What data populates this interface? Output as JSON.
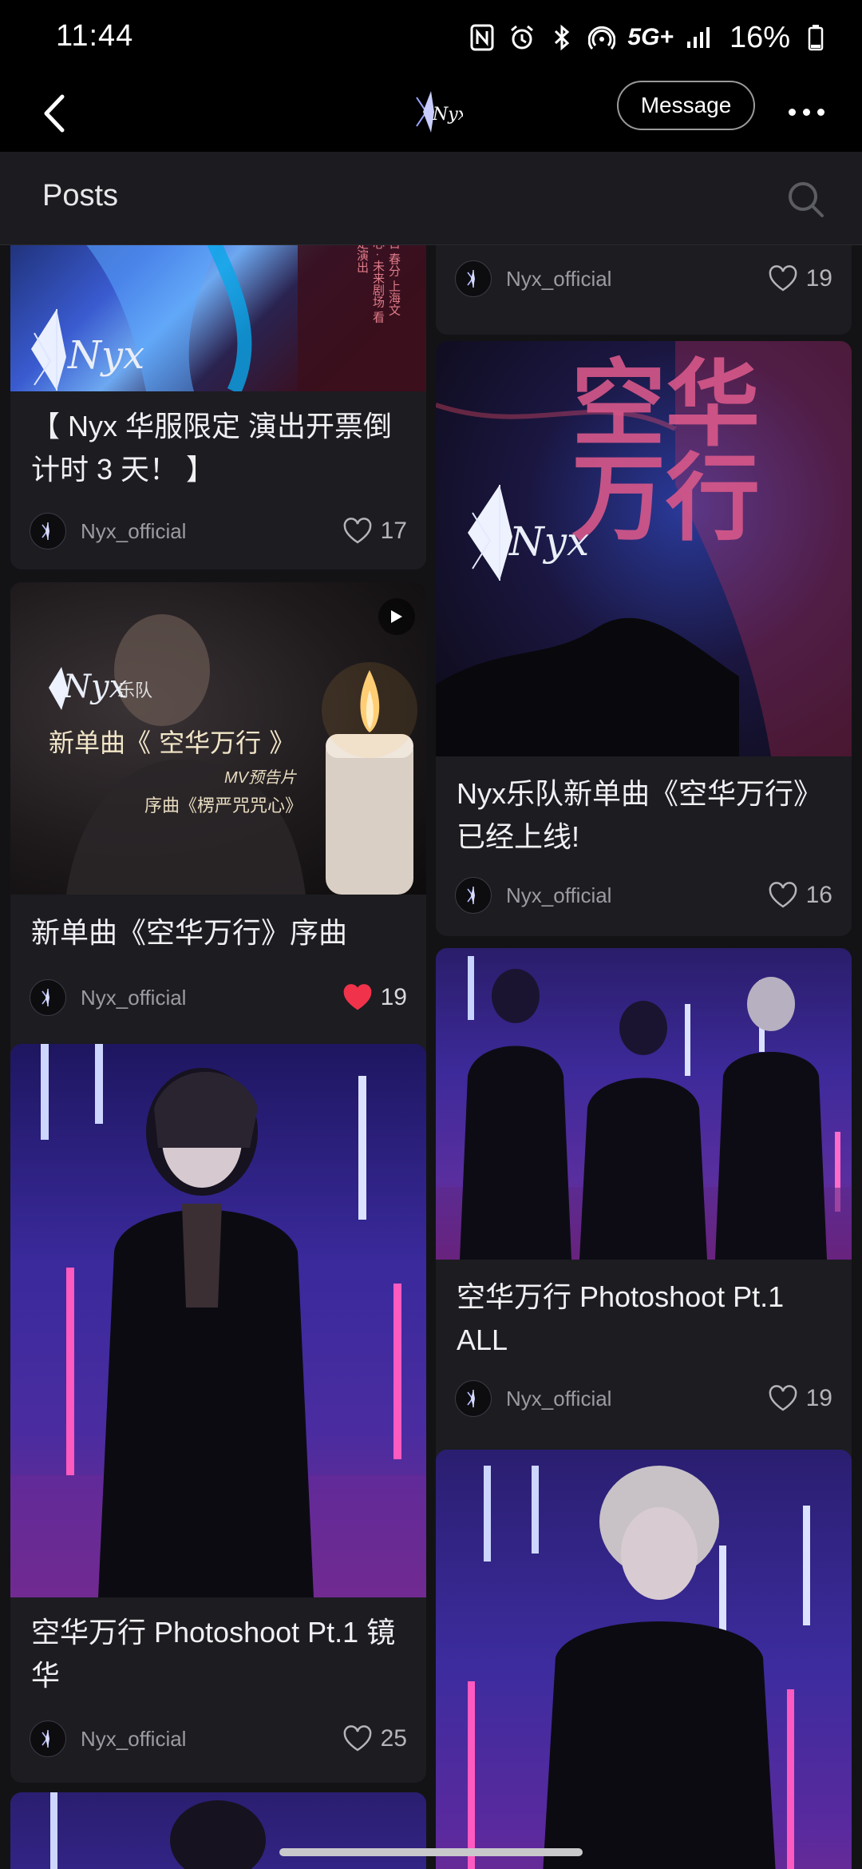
{
  "status_bar": {
    "time": "11:44",
    "network": "5G+",
    "battery": "16%",
    "icons": [
      "nfc-icon",
      "alarm-icon",
      "bluetooth-icon",
      "hotspot-icon",
      "signal-icon",
      "battery-icon"
    ]
  },
  "top_bar": {
    "back_icon": "chevron-left-icon",
    "logo_text": "Nyx",
    "message_label": "Message",
    "more_icon": "more-horizontal-icon"
  },
  "posts_header": {
    "title": "Posts",
    "search_icon": "search-icon"
  },
  "posts": [
    {
      "title": "",
      "author": "Nyx_official",
      "likes": "19",
      "liked": false,
      "image": null
    },
    {
      "title": "【 Nyx 华服限定 演出开票倒计时 3 天！ 】",
      "author": "Nyx_official",
      "likes": "17",
      "liked": false,
      "image": {
        "logo_text": "Nyx",
        "poster_text": "二十日 春分 上海文化中心 · 未来剧场 看最限定演出"
      }
    },
    {
      "title": "Nyx乐队新单曲《空华万行》已经上线!",
      "author": "Nyx_official",
      "likes": "16",
      "liked": false,
      "image": {
        "logo_text": "Nyx",
        "calligraphy": "空华万行"
      }
    },
    {
      "title": "新单曲《空华万行》序曲",
      "author": "Nyx_official",
      "likes": "19",
      "liked": true,
      "image": {
        "logo_text": "Nyx",
        "band_label": "乐队",
        "line1": "新单曲《 空华万行 》",
        "line2": "MV预告片",
        "line3": "序曲《楞严咒咒心》",
        "video": true
      }
    },
    {
      "title": "空华万行 Photoshoot Pt.1 ALL",
      "author": "Nyx_official",
      "likes": "19",
      "liked": false,
      "image": {
        "kind": "group-photo"
      }
    },
    {
      "title": "空华万行 Photoshoot Pt.1 镜华",
      "author": "Nyx_official",
      "likes": "25",
      "liked": false,
      "image": {
        "kind": "solo-photo"
      }
    },
    {
      "title": "",
      "author": "",
      "likes": "",
      "liked": false,
      "image": {
        "kind": "solo-photo"
      }
    },
    {
      "title": "",
      "author": "",
      "likes": "",
      "liked": false,
      "image": {
        "kind": "solo-photo"
      }
    }
  ],
  "colors": {
    "background": "#131316",
    "card": "#1c1c21",
    "liked_heart": "#f0334a",
    "neon_purple": "#6a2bd9",
    "neon_pink": "#e0338a"
  }
}
